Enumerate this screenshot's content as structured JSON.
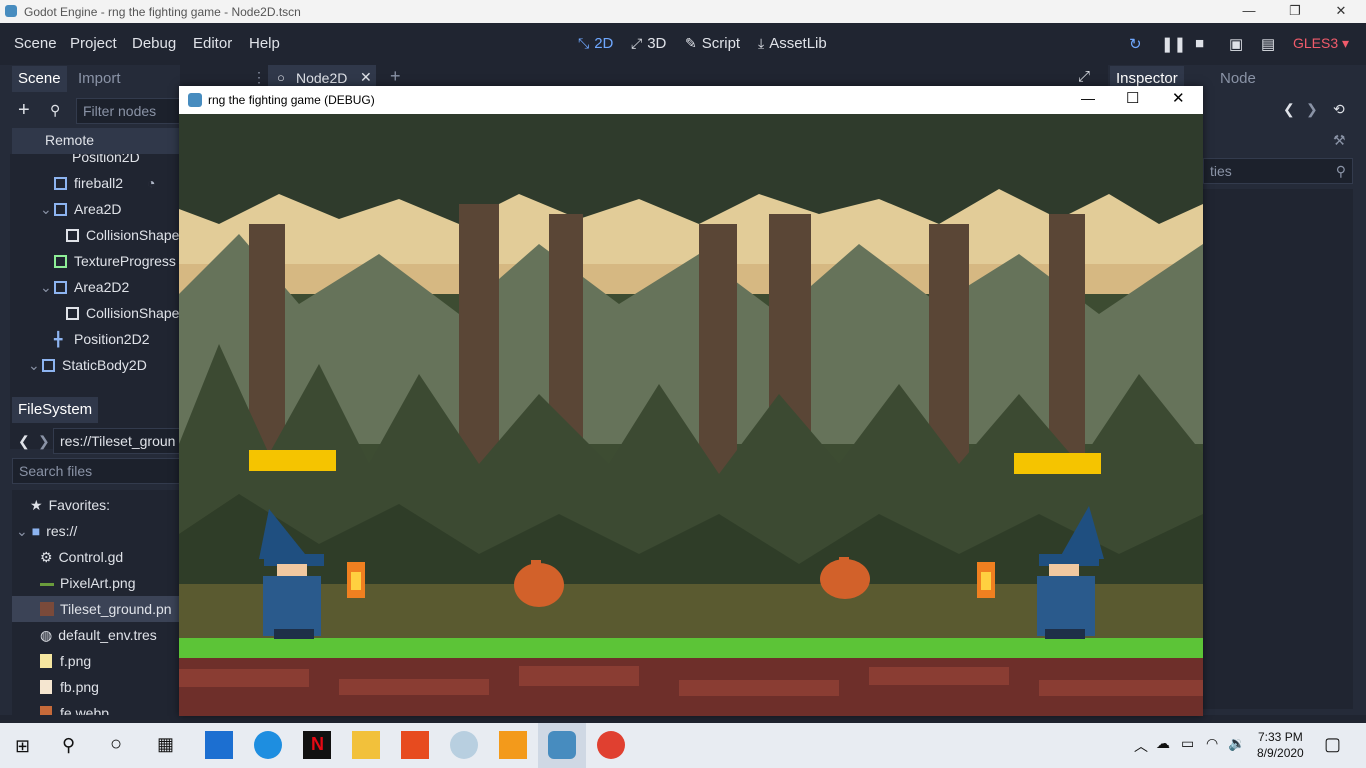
{
  "os": {
    "window_title": "Godot Engine - rng the fighting game - Node2D.tscn",
    "minimize_glyph": "—",
    "maximize_glyph": "❐",
    "close_glyph": "✕"
  },
  "menubar": {
    "items": [
      "Scene",
      "Project",
      "Debug",
      "Editor",
      "Help"
    ],
    "workspaces": [
      {
        "label": "2D",
        "icon": "2d-icon",
        "active": true
      },
      {
        "label": "3D",
        "icon": "3d-icon",
        "active": false
      },
      {
        "label": "Script",
        "icon": "script-icon",
        "active": false
      },
      {
        "label": "AssetLib",
        "icon": "assetlib-icon",
        "active": false
      }
    ],
    "renderer": "GLES3",
    "accent_active": "#6fa8ff",
    "renderer_color": "#f05b6b"
  },
  "scene_dock": {
    "tabs": [
      "Scene",
      "Import"
    ],
    "filter_placeholder": "Filter nodes",
    "remote_label": "Remote",
    "nodes": [
      {
        "label": "Position2D"
      },
      {
        "label": "fireball2"
      },
      {
        "label": "Area2D"
      },
      {
        "label": "CollisionShape"
      },
      {
        "label": "TextureProgress"
      },
      {
        "label": "Area2D2"
      },
      {
        "label": "CollisionShape"
      },
      {
        "label": "Position2D2"
      },
      {
        "label": "StaticBody2D"
      }
    ]
  },
  "filesystem_dock": {
    "tab": "FileSystem",
    "path": "res://Tileset_groun",
    "search_placeholder": "Search files",
    "items": [
      {
        "label": "Favorites:",
        "icon": "star-icon"
      },
      {
        "label": "res://",
        "icon": "folder-icon"
      },
      {
        "label": "Control.gd",
        "icon": "gear-icon"
      },
      {
        "label": "PixelArt.png",
        "icon": "image-icon"
      },
      {
        "label": "Tileset_ground.pn",
        "icon": "image-icon",
        "selected": true
      },
      {
        "label": "default_env.tres",
        "icon": "globe-icon"
      },
      {
        "label": "f.png",
        "icon": "image-icon"
      },
      {
        "label": "fb.png",
        "icon": "image-icon"
      },
      {
        "label": "fe.webp",
        "icon": "image-icon"
      }
    ]
  },
  "editor": {
    "scene_tab": "Node2D",
    "inspector_tabs": [
      "Inspector",
      "Node"
    ],
    "inspector_filter_partial": "ties"
  },
  "game_window": {
    "title": "rng the fighting game (DEBUG)",
    "health_bar_color": "#f5c400"
  },
  "taskbar": {
    "time": "7:33 PM",
    "date": "8/9/2020"
  }
}
